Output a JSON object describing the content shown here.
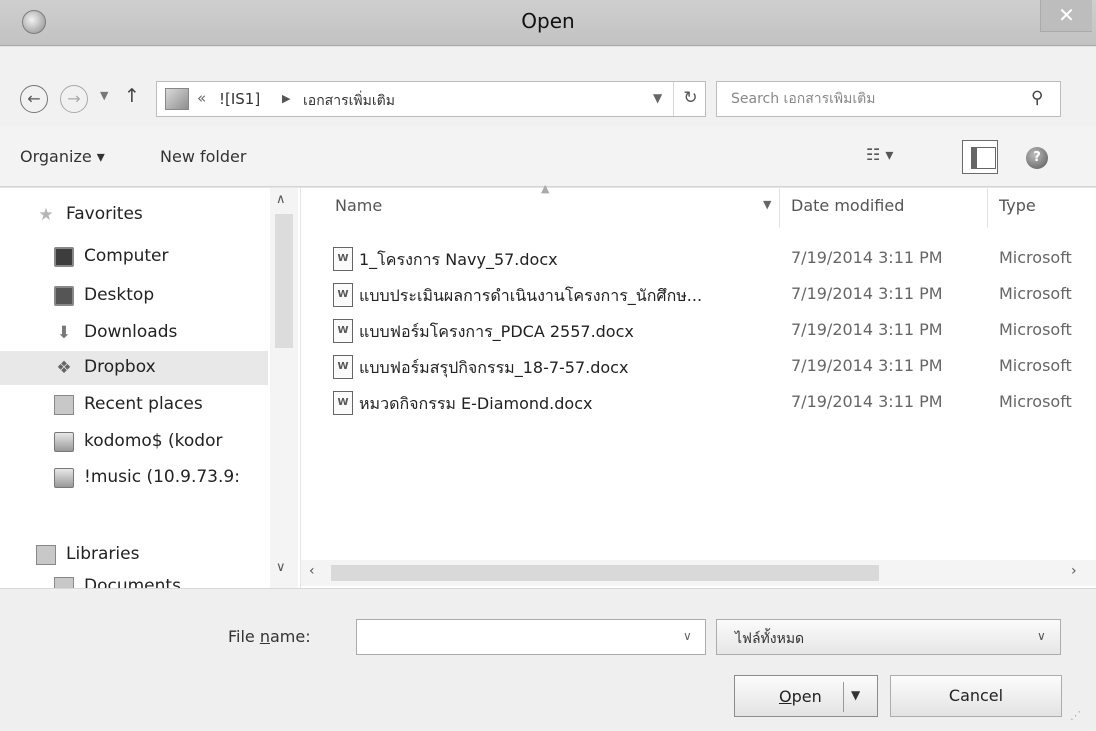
{
  "window": {
    "title": "Open",
    "close_symbol": "✕"
  },
  "nav": {
    "back_icon": "back-arrow-icon",
    "forward_icon": "forward-arrow-icon",
    "up_icon": "up-arrow-icon"
  },
  "address": {
    "chevron": "«",
    "crumbs": [
      "![IS1]",
      "เอกสารเพิ่มเติม"
    ]
  },
  "search": {
    "placeholder": "Search เอกสารเพิ่มเติม"
  },
  "toolbar": {
    "organize_label": "Organize ▾",
    "new_folder_label": "New folder"
  },
  "sidebar": {
    "items": [
      {
        "label": "Favorites",
        "icon": "star-icon",
        "level": 0
      },
      {
        "label": "Computer",
        "icon": "computer-icon",
        "level": 1
      },
      {
        "label": "Desktop",
        "icon": "desktop-icon",
        "level": 1
      },
      {
        "label": "Downloads",
        "icon": "downloads-icon",
        "level": 1
      },
      {
        "label": "Dropbox",
        "icon": "dropbox-icon",
        "level": 1,
        "selected": true
      },
      {
        "label": "Recent places",
        "icon": "recent-places-icon",
        "level": 1
      },
      {
        "label": "kodomo$ (kodor",
        "icon": "network-drive-icon",
        "level": 1
      },
      {
        "label": "!music (10.9.73.9:",
        "icon": "network-drive-icon",
        "level": 1
      },
      {
        "label": "Libraries",
        "icon": "libraries-icon",
        "level": 0
      },
      {
        "label": "Documents",
        "icon": "documents-icon",
        "level": 1
      }
    ]
  },
  "filelist": {
    "columns": [
      "Name",
      "Date modified",
      "Type"
    ],
    "files": [
      {
        "name": "1_โครงการ Navy_57.docx",
        "date": "7/19/2014 3:11 PM",
        "type": "Microsoft"
      },
      {
        "name": "แบบประเมินผลการดำเนินงานโครงการ_นักศึกษ...",
        "date": "7/19/2014 3:11 PM",
        "type": "Microsoft"
      },
      {
        "name": "แบบฟอร์มโครงการ_PDCA 2557.docx",
        "date": "7/19/2014 3:11 PM",
        "type": "Microsoft"
      },
      {
        "name": "แบบฟอร์มสรุปกิจกรรม_18-7-57.docx",
        "date": "7/19/2014 3:11 PM",
        "type": "Microsoft"
      },
      {
        "name": "หมวดกิจกรรม E-Diamond.docx",
        "date": "7/19/2014 3:11 PM",
        "type": "Microsoft"
      }
    ]
  },
  "footer": {
    "file_name_label_pre": "File ",
    "file_name_label_u": "n",
    "file_name_label_post": "ame:",
    "file_name_value": "",
    "filter_label": "ไฟล์ทั้งหมด",
    "open_label_u": "O",
    "open_label_rest": "pen",
    "cancel_label": "Cancel"
  }
}
